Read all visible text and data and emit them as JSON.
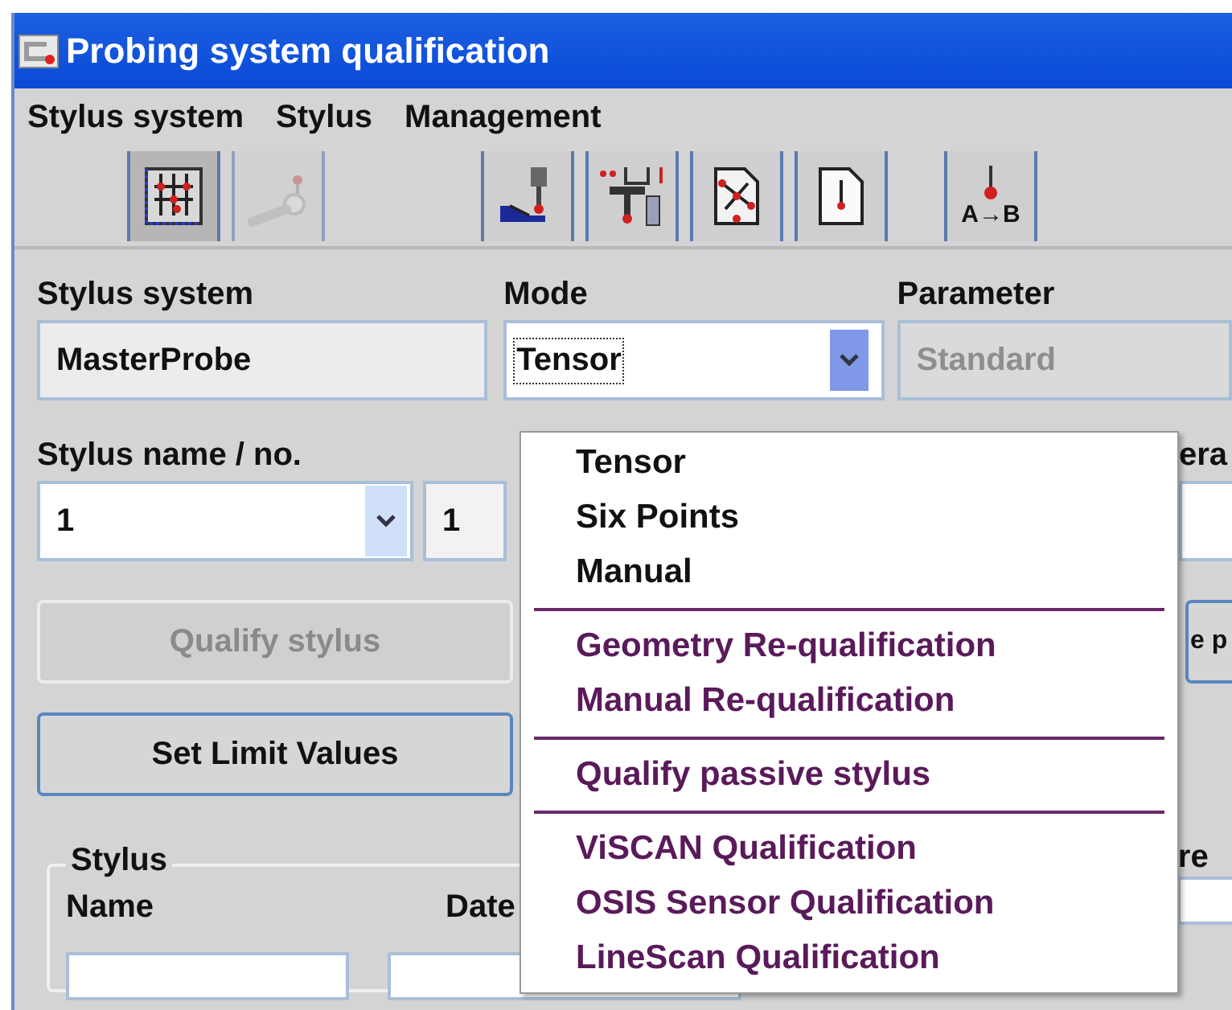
{
  "window": {
    "title": "Probing system qualification"
  },
  "menu": [
    "Stylus system",
    "Stylus",
    "Management"
  ],
  "toolbar": [
    {
      "kind": "probe-grid",
      "pressed": true,
      "disabled": false,
      "gap_before": false
    },
    {
      "kind": "stylus",
      "pressed": false,
      "disabled": true,
      "gap_before": false
    },
    {
      "kind": "hand-probe",
      "pressed": false,
      "disabled": false,
      "gap_before": true
    },
    {
      "kind": "probe-measure",
      "pressed": false,
      "disabled": false,
      "gap_before": false
    },
    {
      "kind": "sheet-points",
      "pressed": false,
      "disabled": false,
      "gap_before": false
    },
    {
      "kind": "sheet-probe",
      "pressed": false,
      "disabled": false,
      "gap_before": false
    },
    {
      "kind": "probe-ab",
      "label": "A→B",
      "pressed": false,
      "disabled": false,
      "gap_before": true
    }
  ],
  "stylus_system": {
    "label": "Stylus system",
    "value": "MasterProbe"
  },
  "mode": {
    "label": "Mode",
    "value": "Tensor",
    "open": true
  },
  "parameter": {
    "label": "Parameter",
    "value": "Standard",
    "disabled": true
  },
  "stylus_name": {
    "label": "Stylus name / no.",
    "value": "1",
    "number": "1"
  },
  "buttons": [
    {
      "label": "Qualify stylus",
      "disabled": true
    },
    {
      "label": "Set Limit Values",
      "disabled": false
    }
  ],
  "stylus_group": {
    "title": "Stylus",
    "columns": [
      "Name",
      "Date"
    ]
  },
  "hidden_right": {
    "label_1": "era",
    "button": "e p",
    "label_2": "re"
  },
  "mode_menu": [
    {
      "kind": "item",
      "label": "Tensor",
      "color": "#111111"
    },
    {
      "kind": "item",
      "label": "Six Points",
      "color": "#111111"
    },
    {
      "kind": "item",
      "label": "Manual",
      "color": "#111111"
    },
    {
      "kind": "separator"
    },
    {
      "kind": "item",
      "label": "Geometry Re-qualification",
      "color": "#5a1a5a"
    },
    {
      "kind": "item",
      "label": "Manual Re-qualification",
      "color": "#5a1a5a"
    },
    {
      "kind": "separator"
    },
    {
      "kind": "item",
      "label": "Qualify passive stylus",
      "color": "#5a1a5a"
    },
    {
      "kind": "separator"
    },
    {
      "kind": "item",
      "label": "ViSCAN Qualification",
      "color": "#5a1a5a"
    },
    {
      "kind": "item",
      "label": "OSIS Sensor Qualification",
      "color": "#5a1a5a"
    },
    {
      "kind": "item",
      "label": "LineScan Qualification",
      "color": "#5a1a5a"
    }
  ]
}
